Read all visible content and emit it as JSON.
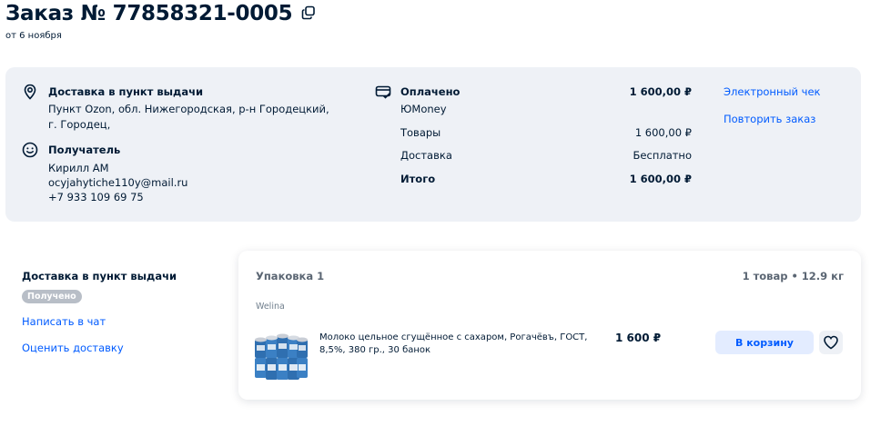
{
  "header": {
    "title": "Заказ № 77858321-0005",
    "date": "от 6 ноября"
  },
  "delivery": {
    "label": "Доставка в пункт выдачи",
    "address": "Пункт Ozon, обл. Нижегородская, р-н Городецкий, г. Городец,"
  },
  "recipient": {
    "label": "Получатель",
    "name": "Кирилл АМ",
    "email": "ocyjahytiche110y@mail.ru",
    "phone": "+7 933 109 69 75"
  },
  "payment": {
    "status": "Оплачено",
    "total_top": "1 600,00 ₽",
    "method": "ЮMoney",
    "goods_label": "Товары",
    "goods_value": "1 600,00 ₽",
    "shipping_label": "Доставка",
    "shipping_value": "Бесплатно",
    "total_label": "Итого",
    "total_value": "1 600,00 ₽"
  },
  "actions": {
    "receipt": "Электронный чек",
    "repeat": "Повторить заказ"
  },
  "shipment": {
    "label": "Доставка в пункт выдачи",
    "status": "Получено",
    "chat": "Написать в чат",
    "rate": "Оценить доставку"
  },
  "package": {
    "title": "Упаковка 1",
    "meta": "1 товар • 12.9 кг",
    "brand": "Welina",
    "product_name": "Молоко цельное сгущённое с сахаром, Рогачёвъ, ГОСТ, 8,5%, 380 гр., 30 банок",
    "price": "1 600 ₽",
    "cart_button": "В корзину"
  },
  "colors": {
    "accent": "#005bff",
    "card_bg": "#eef1f6",
    "badge_bg": "#b8bec7"
  }
}
